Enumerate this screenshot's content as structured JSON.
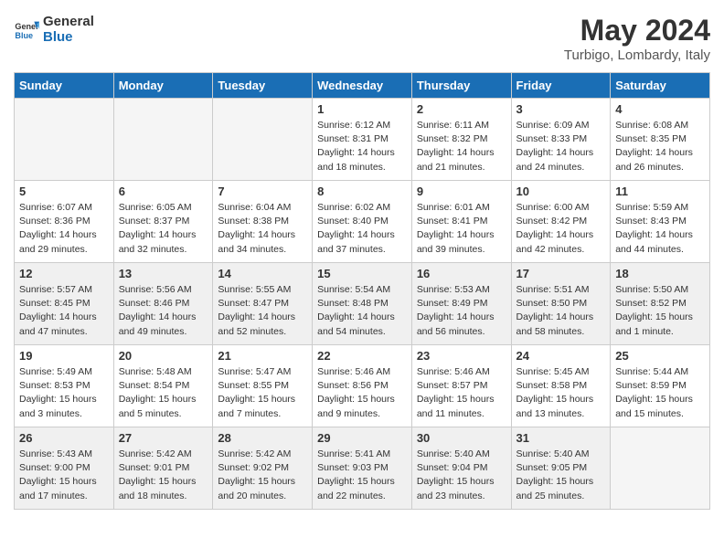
{
  "header": {
    "logo_line1": "General",
    "logo_line2": "Blue",
    "month": "May 2024",
    "location": "Turbigo, Lombardy, Italy"
  },
  "weekdays": [
    "Sunday",
    "Monday",
    "Tuesday",
    "Wednesday",
    "Thursday",
    "Friday",
    "Saturday"
  ],
  "weeks": [
    [
      {
        "day": "",
        "empty": true
      },
      {
        "day": "",
        "empty": true
      },
      {
        "day": "",
        "empty": true
      },
      {
        "day": "1",
        "sunrise": "6:12 AM",
        "sunset": "8:31 PM",
        "daylight": "14 hours and 18 minutes."
      },
      {
        "day": "2",
        "sunrise": "6:11 AM",
        "sunset": "8:32 PM",
        "daylight": "14 hours and 21 minutes."
      },
      {
        "day": "3",
        "sunrise": "6:09 AM",
        "sunset": "8:33 PM",
        "daylight": "14 hours and 24 minutes."
      },
      {
        "day": "4",
        "sunrise": "6:08 AM",
        "sunset": "8:35 PM",
        "daylight": "14 hours and 26 minutes."
      }
    ],
    [
      {
        "day": "5",
        "sunrise": "6:07 AM",
        "sunset": "8:36 PM",
        "daylight": "14 hours and 29 minutes."
      },
      {
        "day": "6",
        "sunrise": "6:05 AM",
        "sunset": "8:37 PM",
        "daylight": "14 hours and 32 minutes."
      },
      {
        "day": "7",
        "sunrise": "6:04 AM",
        "sunset": "8:38 PM",
        "daylight": "14 hours and 34 minutes."
      },
      {
        "day": "8",
        "sunrise": "6:02 AM",
        "sunset": "8:40 PM",
        "daylight": "14 hours and 37 minutes."
      },
      {
        "day": "9",
        "sunrise": "6:01 AM",
        "sunset": "8:41 PM",
        "daylight": "14 hours and 39 minutes."
      },
      {
        "day": "10",
        "sunrise": "6:00 AM",
        "sunset": "8:42 PM",
        "daylight": "14 hours and 42 minutes."
      },
      {
        "day": "11",
        "sunrise": "5:59 AM",
        "sunset": "8:43 PM",
        "daylight": "14 hours and 44 minutes."
      }
    ],
    [
      {
        "day": "12",
        "sunrise": "5:57 AM",
        "sunset": "8:45 PM",
        "daylight": "14 hours and 47 minutes."
      },
      {
        "day": "13",
        "sunrise": "5:56 AM",
        "sunset": "8:46 PM",
        "daylight": "14 hours and 49 minutes."
      },
      {
        "day": "14",
        "sunrise": "5:55 AM",
        "sunset": "8:47 PM",
        "daylight": "14 hours and 52 minutes."
      },
      {
        "day": "15",
        "sunrise": "5:54 AM",
        "sunset": "8:48 PM",
        "daylight": "14 hours and 54 minutes."
      },
      {
        "day": "16",
        "sunrise": "5:53 AM",
        "sunset": "8:49 PM",
        "daylight": "14 hours and 56 minutes."
      },
      {
        "day": "17",
        "sunrise": "5:51 AM",
        "sunset": "8:50 PM",
        "daylight": "14 hours and 58 minutes."
      },
      {
        "day": "18",
        "sunrise": "5:50 AM",
        "sunset": "8:52 PM",
        "daylight": "15 hours and 1 minute."
      }
    ],
    [
      {
        "day": "19",
        "sunrise": "5:49 AM",
        "sunset": "8:53 PM",
        "daylight": "15 hours and 3 minutes."
      },
      {
        "day": "20",
        "sunrise": "5:48 AM",
        "sunset": "8:54 PM",
        "daylight": "15 hours and 5 minutes."
      },
      {
        "day": "21",
        "sunrise": "5:47 AM",
        "sunset": "8:55 PM",
        "daylight": "15 hours and 7 minutes."
      },
      {
        "day": "22",
        "sunrise": "5:46 AM",
        "sunset": "8:56 PM",
        "daylight": "15 hours and 9 minutes."
      },
      {
        "day": "23",
        "sunrise": "5:46 AM",
        "sunset": "8:57 PM",
        "daylight": "15 hours and 11 minutes."
      },
      {
        "day": "24",
        "sunrise": "5:45 AM",
        "sunset": "8:58 PM",
        "daylight": "15 hours and 13 minutes."
      },
      {
        "day": "25",
        "sunrise": "5:44 AM",
        "sunset": "8:59 PM",
        "daylight": "15 hours and 15 minutes."
      }
    ],
    [
      {
        "day": "26",
        "sunrise": "5:43 AM",
        "sunset": "9:00 PM",
        "daylight": "15 hours and 17 minutes."
      },
      {
        "day": "27",
        "sunrise": "5:42 AM",
        "sunset": "9:01 PM",
        "daylight": "15 hours and 18 minutes."
      },
      {
        "day": "28",
        "sunrise": "5:42 AM",
        "sunset": "9:02 PM",
        "daylight": "15 hours and 20 minutes."
      },
      {
        "day": "29",
        "sunrise": "5:41 AM",
        "sunset": "9:03 PM",
        "daylight": "15 hours and 22 minutes."
      },
      {
        "day": "30",
        "sunrise": "5:40 AM",
        "sunset": "9:04 PM",
        "daylight": "15 hours and 23 minutes."
      },
      {
        "day": "31",
        "sunrise": "5:40 AM",
        "sunset": "9:05 PM",
        "daylight": "15 hours and 25 minutes."
      },
      {
        "day": "",
        "empty": true
      }
    ]
  ],
  "labels": {
    "sunrise": "Sunrise:",
    "sunset": "Sunset:",
    "daylight": "Daylight:"
  }
}
